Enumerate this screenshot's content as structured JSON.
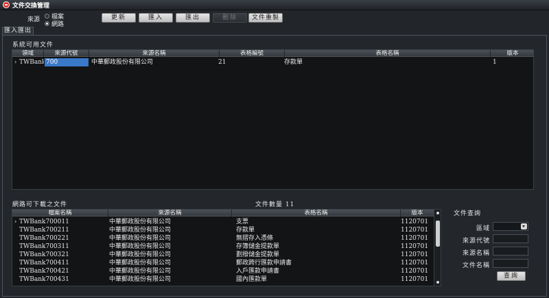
{
  "window": {
    "title": "文件交換管理"
  },
  "toolbar": {
    "source_label": "來源",
    "radio_file": "檔案",
    "radio_network": "網路",
    "refresh": "更新",
    "import": "匯入",
    "export": "匯出",
    "delete": "刪除",
    "reset": "文件重製"
  },
  "tabs": {
    "import_export": "匯入匯出"
  },
  "available": {
    "section": "系統可用文件",
    "headers": [
      "領域",
      "來源代號",
      "來源名稱",
      "表格編號",
      "表格名稱",
      "版本"
    ],
    "rows": [
      {
        "domain": "TWBank",
        "source_code": "700",
        "source_name": "中華郵政股份有限公司",
        "form_no": "21",
        "form_name": "存款單",
        "version": "1"
      }
    ]
  },
  "downloadable": {
    "section": "網路可下載之文件",
    "count_label": "文件數量 11",
    "headers": [
      "檔案名稱",
      "來源名稱",
      "表格名稱",
      "版本"
    ],
    "rows": [
      {
        "file": "TWBank700011",
        "source": "中華郵政股份有限公司",
        "form": "支票",
        "version": "1120701"
      },
      {
        "file": "TWBank700211",
        "source": "中華郵政股份有限公司",
        "form": "存款單",
        "version": "1120701"
      },
      {
        "file": "TWBank700221",
        "source": "中華郵政股份有限公司",
        "form": "無摺存入憑條",
        "version": "1120701"
      },
      {
        "file": "TWBank700311",
        "source": "中華郵政股份有限公司",
        "form": "存簿儲金提款單",
        "version": "1120701"
      },
      {
        "file": "TWBank700321",
        "source": "中華郵政股份有限公司",
        "form": "劃撥儲金提款單",
        "version": "1120701"
      },
      {
        "file": "TWBank700411",
        "source": "中華郵政股份有限公司",
        "form": "郵政跨行匯款申請書",
        "version": "1120701"
      },
      {
        "file": "TWBank700421",
        "source": "中華郵政股份有限公司",
        "form": "入戶匯款申請書",
        "version": "1120701"
      },
      {
        "file": "TWBank700431",
        "source": "中華郵政股份有限公司",
        "form": "國內匯款單",
        "version": "1120701"
      }
    ]
  },
  "query": {
    "title": "文件查詢",
    "domain_label": "區域",
    "source_code_label": "來源代號",
    "source_name_label": "來源名稱",
    "file_name_label": "文件名稱",
    "search_button": "查詢"
  }
}
